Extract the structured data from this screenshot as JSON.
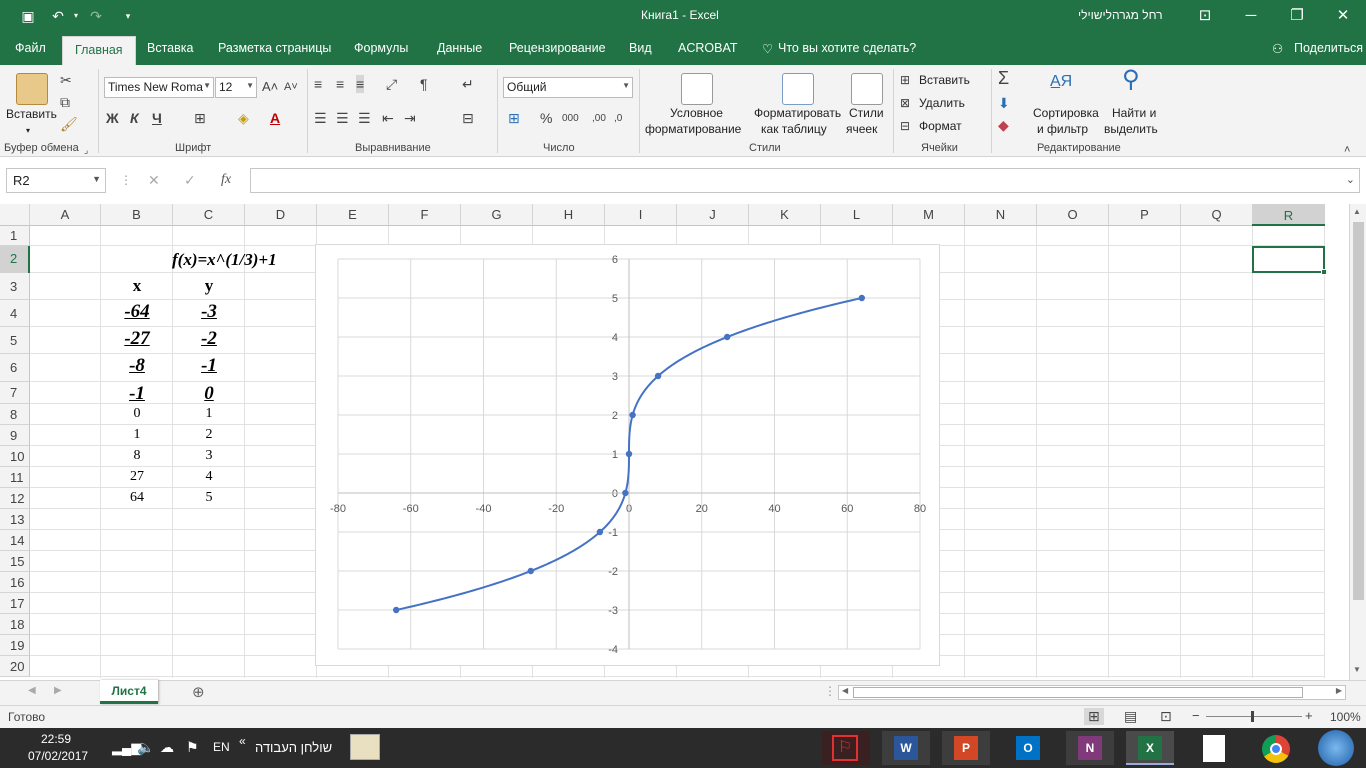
{
  "titlebar": {
    "title": "Книга1  -  Excel",
    "user": "רחל מגרהלישוילי"
  },
  "tabs": [
    "Файл",
    "Главная",
    "Вставка",
    "Разметка страницы",
    "Формулы",
    "Данные",
    "Рецензирование",
    "Вид",
    "ACROBAT"
  ],
  "tell_me": "Что вы хотите сделать?",
  "share": "Поделиться",
  "ribbon": {
    "paste": "Вставить",
    "clipboard": "Буфер обмена",
    "font_name": "Times New Roma",
    "font_size": "12",
    "font": "Шрифт",
    "bold": "Ж",
    "italic": "К",
    "underline": "Ч",
    "alignment": "Выравнивание",
    "number_format": "Общий",
    "number": "Число",
    "cond_fmt_1": "Условное",
    "cond_fmt_2": "форматирование",
    "fmt_table_1": "Форматировать",
    "fmt_table_2": "как таблицу",
    "cell_styles_1": "Стили",
    "cell_styles_2": "ячеек",
    "styles": "Стили",
    "insert": "Вставить",
    "delete": "Удалить",
    "format": "Формат",
    "cells": "Ячейки",
    "sort_1": "Сортировка",
    "sort_2": "и фильтр",
    "find_1": "Найти и",
    "find_2": "выделить",
    "editing": "Редактирование"
  },
  "namebox": "R2",
  "fx": "fx",
  "columns": [
    "A",
    "B",
    "C",
    "D",
    "E",
    "F",
    "G",
    "H",
    "I",
    "J",
    "K",
    "L",
    "M",
    "N",
    "O",
    "P",
    "Q",
    "R"
  ],
  "rows": [
    "1",
    "2",
    "3",
    "4",
    "5",
    "6",
    "7",
    "8",
    "9",
    "10",
    "11",
    "12",
    "13",
    "14",
    "15",
    "16",
    "17",
    "18",
    "19",
    "20"
  ],
  "cells": {
    "formula": "f(x)=x^(1/3)+1",
    "x_header": "x",
    "y_header": "y",
    "x": [
      "-64",
      "-27",
      "-8",
      "-1",
      "0",
      "1",
      "8",
      "27",
      "64"
    ],
    "y": [
      "-3",
      "-2",
      "-1",
      "0",
      "1",
      "2",
      "3",
      "4",
      "5"
    ]
  },
  "chart_data": {
    "type": "scatter",
    "x": [
      -64,
      -27,
      -8,
      -1,
      0,
      1,
      8,
      27,
      64
    ],
    "y": [
      -3,
      -2,
      -1,
      0,
      1,
      2,
      3,
      4,
      5
    ],
    "xlim": [
      -80,
      80
    ],
    "ylim": [
      -4,
      6
    ],
    "xticks": [
      "-80",
      "-60",
      "-40",
      "-20",
      "0",
      "20",
      "40",
      "60",
      "80"
    ],
    "yticks": [
      "6",
      "5",
      "4",
      "3",
      "2",
      "1",
      "0",
      "-1",
      "-2",
      "-3",
      "-4"
    ],
    "grid": true,
    "smooth": true,
    "line_color": "#4472c4"
  },
  "sheet_tab": "Лист4",
  "status": "Готово",
  "zoom": "100%",
  "taskbar": {
    "time": "22:59",
    "date": "07/02/2017",
    "lang": "EN",
    "desk": "שולחן העבודה"
  }
}
